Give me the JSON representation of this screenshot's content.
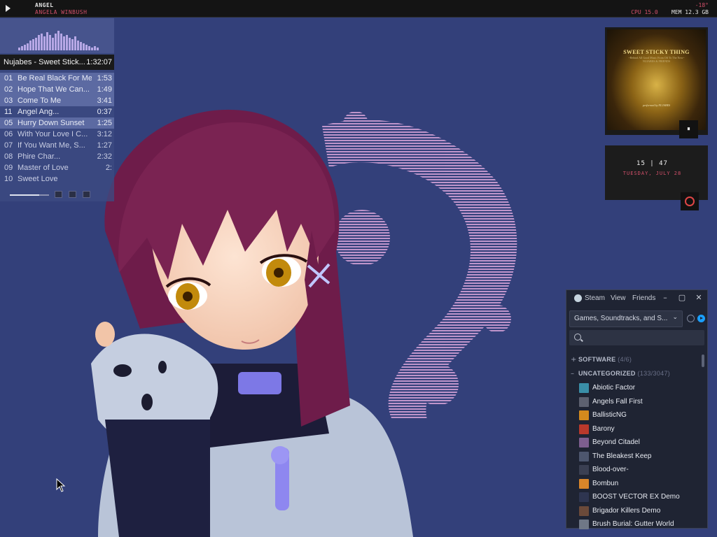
{
  "topbar": {
    "track_title": "ANGEL",
    "track_artist": "ANGELA WINBUSH",
    "temperature": "-18°",
    "cpu_label": "CPU",
    "cpu_value": "15.0",
    "mem_label": "MEM",
    "mem_value": "12.3 GB"
  },
  "player": {
    "now_playing": "Nujabes - Sweet Stick...",
    "total_time": "1:32:07",
    "tracks": [
      {
        "num": "01",
        "title": "Be Real Black For Me",
        "dur": "1:53"
      },
      {
        "num": "02",
        "title": "Hope That We Can...",
        "dur": "1:49"
      },
      {
        "num": "03",
        "title": "Come To Me",
        "dur": "3:41"
      },
      {
        "num": "11",
        "title": "Angel  Ang...",
        "dur": "0:37"
      },
      {
        "num": "05",
        "title": "Hurry Down Sunset",
        "dur": "1:25"
      },
      {
        "num": "06",
        "title": "With Your Love I C...",
        "dur": "3:12"
      },
      {
        "num": "07",
        "title": "If You Want Me, S...",
        "dur": "1:27"
      },
      {
        "num": "08",
        "title": "Phire  Char...",
        "dur": "2:32"
      },
      {
        "num": "09",
        "title": "Master of Love",
        "dur": "2:"
      },
      {
        "num": "10",
        "title": "Sweet Love",
        "dur": ""
      }
    ],
    "volume_fraction": 0.75
  },
  "album": {
    "title": "SWEET STICKY THING",
    "subtitle": "~Behind All Good Music From Off To The Now~",
    "subtitle2": "NUJABES & FRIENDS",
    "performer": "performed by NUJABES",
    "pause_label": "⏸"
  },
  "clock": {
    "time": "15 | 47",
    "date": "TUESDAY, JULY 28"
  },
  "steam": {
    "menu": [
      "Steam",
      "View",
      "Friends"
    ],
    "filter": "Games, Soundtracks, and S...",
    "categories": [
      {
        "sign": "+",
        "name": "SOFTWARE",
        "count": "(4/6)"
      },
      {
        "sign": "–",
        "name": "UNCATEGORIZED",
        "count": "(133/3047)"
      }
    ],
    "games": [
      {
        "name": "Abiotic Factor",
        "color": "#3a8fa8"
      },
      {
        "name": "Angels Fall First",
        "color": "#5d6170"
      },
      {
        "name": "BallisticNG",
        "color": "#d38a1d"
      },
      {
        "name": "Barony",
        "color": "#b9392b"
      },
      {
        "name": "Beyond Citadel",
        "color": "#7d5e8f"
      },
      {
        "name": "The Bleakest Keep",
        "color": "#4d566e"
      },
      {
        "name": "Blood-over-",
        "color": "#3a3f52"
      },
      {
        "name": "Bombun",
        "color": "#d9862a"
      },
      {
        "name": "BOOST VECTOR EX Demo",
        "color": "#2e3550"
      },
      {
        "name": "Brigador Killers Demo",
        "color": "#6b4a3a"
      },
      {
        "name": "Brush Burial: Gutter World",
        "color": "#6f7786"
      }
    ]
  }
}
